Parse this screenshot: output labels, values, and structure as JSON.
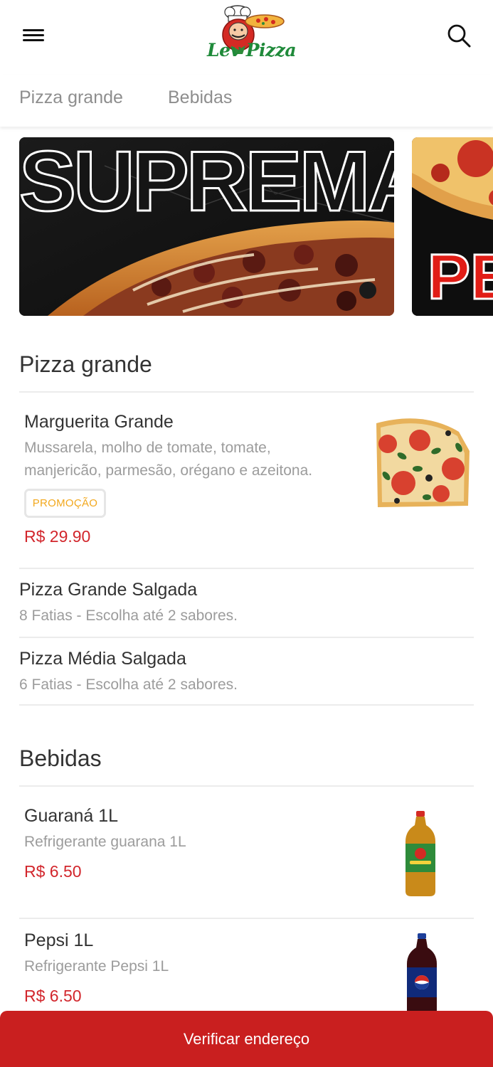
{
  "header": {
    "logo_text": "Lev Pizza",
    "menu_icon": "hamburger-menu-icon",
    "search_icon": "search-icon"
  },
  "tabs": [
    {
      "label": "Pizza grande"
    },
    {
      "label": "Bebidas"
    }
  ],
  "banners": [
    {
      "text": "SUPREMA"
    },
    {
      "text": "PE"
    }
  ],
  "sections": [
    {
      "title": "Pizza grande",
      "items": [
        {
          "name": "Marguerita Grande",
          "description": "Mussarela, molho de tomate, tomate, manjericão, parmesão, orégano e azeitona.",
          "badge": "PROMOÇÃO",
          "price": "R$ 29.90"
        },
        {
          "name": "Pizza Grande Salgada",
          "description": "8 Fatias - Escolha até 2 sabores."
        },
        {
          "name": "Pizza Média Salgada",
          "description": "6 Fatias - Escolha até 2 sabores."
        }
      ]
    },
    {
      "title": "Bebidas",
      "items": [
        {
          "name": "Guaraná 1L",
          "description": "Refrigerante guarana 1L",
          "price": "R$ 6.50"
        },
        {
          "name": "Pepsi 1L",
          "description": "Refrigerante Pepsi 1L",
          "price": "R$ 6.50"
        }
      ]
    }
  ],
  "cta": {
    "label": "Verificar endereço"
  },
  "colors": {
    "accent_red": "#c91f1f",
    "price_red": "#d2262c",
    "badge_orange": "#f2a81d",
    "logo_green": "#1f8a3a"
  }
}
